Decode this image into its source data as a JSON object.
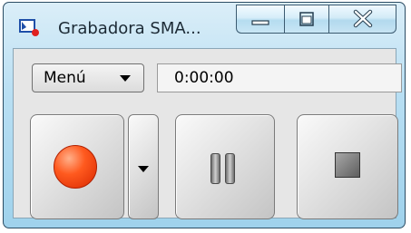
{
  "window": {
    "title": "Grabadora SMA...",
    "controls": {
      "minimize": "minimize-icon",
      "maximize": "maximize-icon",
      "close": "close-icon"
    }
  },
  "toolbar": {
    "menu_label": "Menú",
    "time_display": "0:00:00"
  },
  "buttons": {
    "record_icon": "record-icon",
    "dropdown_icon": "chevron-down-icon",
    "pause_icon": "pause-icon",
    "stop_icon": "stop-icon"
  },
  "colors": {
    "record": "#ff4d16",
    "frame": "#a8d8f0"
  }
}
